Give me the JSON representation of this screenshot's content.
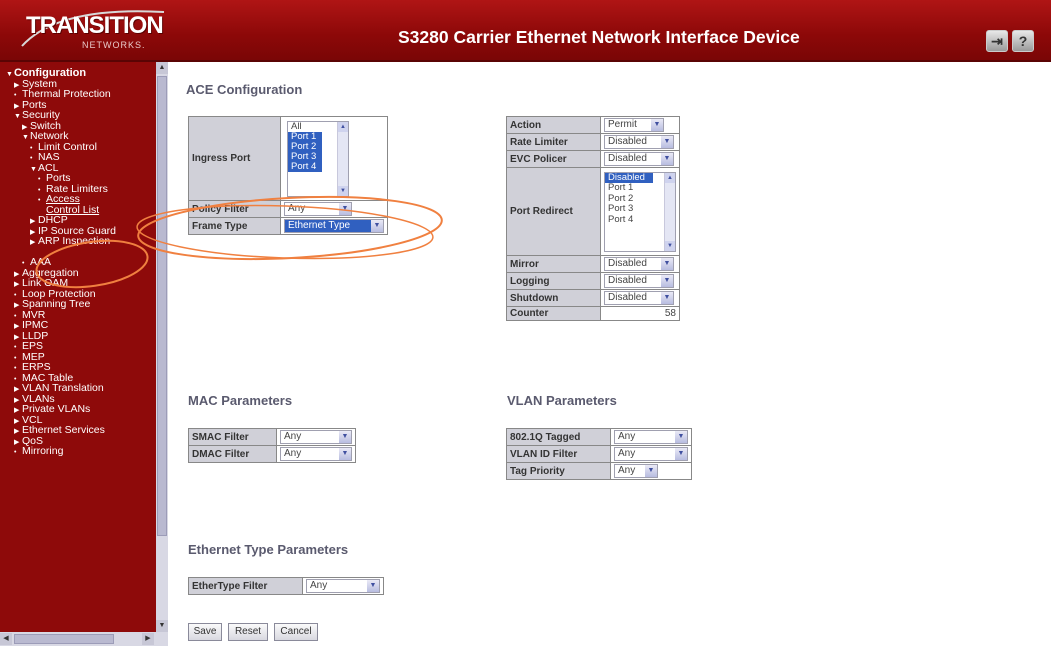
{
  "header": {
    "logo_text": "TRANSITION",
    "logo_subtext": "NETWORKS.",
    "title": "S3280 Carrier Ethernet Network Interface Device",
    "logout_glyph": "⇥",
    "help_glyph": "?",
    "colors": {
      "header_bg": "#9a0c0c",
      "sidebar_bg": "#8e0a0a",
      "accent": "#3060c0"
    }
  },
  "sidebar": {
    "items": [
      {
        "label": "Configuration",
        "level": 0,
        "icon": "caret-down-icon"
      },
      {
        "label": "System",
        "level": 1,
        "icon": "caret-right-icon"
      },
      {
        "label": "Thermal Protection",
        "level": 1,
        "icon": "dot-icon"
      },
      {
        "label": "Ports",
        "level": 1,
        "icon": "caret-right-icon"
      },
      {
        "label": "Security",
        "level": 1,
        "icon": "caret-down-icon"
      },
      {
        "label": "Switch",
        "level": 2,
        "icon": "caret-right-icon"
      },
      {
        "label": "Network",
        "level": 2,
        "icon": "caret-down-icon"
      },
      {
        "label": "Limit Control",
        "level": 3,
        "icon": "dot-icon"
      },
      {
        "label": "NAS",
        "level": 3,
        "icon": "dot-icon"
      },
      {
        "label": "ACL",
        "level": 3,
        "icon": "caret-down-icon"
      },
      {
        "label": "Ports",
        "level": 4,
        "icon": "dot-icon"
      },
      {
        "label": "Rate Limiters",
        "level": 4,
        "icon": "dot-icon"
      },
      {
        "label": "Access",
        "level": 4,
        "icon": "dot-icon"
      },
      {
        "label": "Control List",
        "level": 5,
        "icon": ""
      },
      {
        "label": "DHCP",
        "level": 3,
        "icon": "caret-right-icon"
      },
      {
        "label": "IP Source Guard",
        "level": 3,
        "icon": "caret-right-icon"
      },
      {
        "label": "ARP Inspection",
        "level": 3,
        "icon": "caret-right-icon"
      },
      {
        "label": "",
        "level": 0,
        "icon": ""
      },
      {
        "label": "AAA",
        "level": 2,
        "icon": "dot-icon"
      },
      {
        "label": "Aggregation",
        "level": 1,
        "icon": "caret-right-icon"
      },
      {
        "label": "Link OAM",
        "level": 1,
        "icon": "caret-right-icon"
      },
      {
        "label": "Loop Protection",
        "level": 1,
        "icon": "dot-icon"
      },
      {
        "label": "Spanning Tree",
        "level": 1,
        "icon": "caret-right-icon"
      },
      {
        "label": "MVR",
        "level": 1,
        "icon": "dot-icon"
      },
      {
        "label": "IPMC",
        "level": 1,
        "icon": "caret-right-icon"
      },
      {
        "label": "LLDP",
        "level": 1,
        "icon": "caret-right-icon"
      },
      {
        "label": "EPS",
        "level": 1,
        "icon": "dot-icon"
      },
      {
        "label": "MEP",
        "level": 1,
        "icon": "dot-icon"
      },
      {
        "label": "ERPS",
        "level": 1,
        "icon": "dot-icon"
      },
      {
        "label": "MAC Table",
        "level": 1,
        "icon": "dot-icon"
      },
      {
        "label": "VLAN Translation",
        "level": 1,
        "icon": "caret-right-icon"
      },
      {
        "label": "VLANs",
        "level": 1,
        "icon": "caret-right-icon"
      },
      {
        "label": "Private VLANs",
        "level": 1,
        "icon": "caret-right-icon"
      },
      {
        "label": "VCL",
        "level": 1,
        "icon": "caret-right-icon"
      },
      {
        "label": "Ethernet Services",
        "level": 1,
        "icon": "caret-right-icon"
      },
      {
        "label": "QoS",
        "level": 1,
        "icon": "caret-right-icon"
      },
      {
        "label": "Mirroring",
        "level": 1,
        "icon": "dot-icon"
      }
    ]
  },
  "main": {
    "page_title": "ACE Configuration",
    "ace_left": {
      "ingress_port_label": "Ingress Port",
      "ingress_port_options": [
        "All",
        "Port 1",
        "Port 2",
        "Port 3",
        "Port 4"
      ],
      "policy_filter_label": "Policy Filter",
      "policy_filter_value": "Any",
      "frame_type_label": "Frame Type",
      "frame_type_value": "Ethernet Type"
    },
    "ace_right": {
      "action_label": "Action",
      "action_value": "Permit",
      "rate_limiter_label": "Rate Limiter",
      "rate_limiter_value": "Disabled",
      "evc_policer_label": "EVC Policer",
      "evc_policer_value": "Disabled",
      "port_redirect_label": "Port Redirect",
      "port_redirect_options": [
        "Disabled",
        "Port 1",
        "Port 2",
        "Port 3",
        "Port 4"
      ],
      "mirror_label": "Mirror",
      "mirror_value": "Disabled",
      "logging_label": "Logging",
      "logging_value": "Disabled",
      "shutdown_label": "Shutdown",
      "shutdown_value": "Disabled",
      "counter_label": "Counter",
      "counter_value": "58"
    },
    "mac": {
      "heading": "MAC Parameters",
      "smac_label": "SMAC Filter",
      "smac_value": "Any",
      "dmac_label": "DMAC Filter",
      "dmac_value": "Any"
    },
    "vlan": {
      "heading": "VLAN Parameters",
      "tagged_label": "802.1Q Tagged",
      "tagged_value": "Any",
      "vid_label": "VLAN ID Filter",
      "vid_value": "Any",
      "prio_label": "Tag Priority",
      "prio_value": "Any"
    },
    "ethertype": {
      "heading": "Ethernet Type Parameters",
      "filter_label": "EtherType Filter",
      "filter_value": "Any"
    },
    "buttons": {
      "save": "Save",
      "reset": "Reset",
      "cancel": "Cancel"
    }
  }
}
